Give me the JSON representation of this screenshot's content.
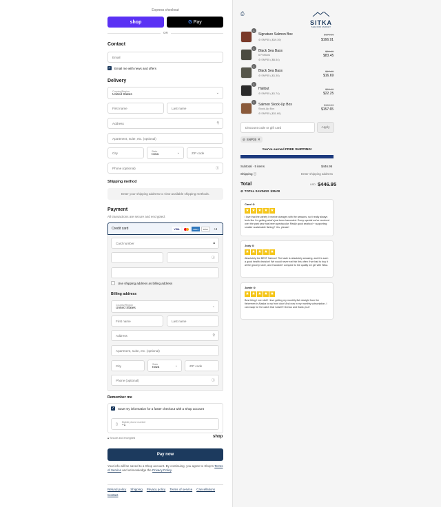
{
  "express": {
    "label": "Express checkout",
    "shop_pay": "shop",
    "gpay": "Pay",
    "or": "OR"
  },
  "contact": {
    "title": "Contact",
    "email_placeholder": "Email",
    "news_label": "Email me with news and offers"
  },
  "delivery": {
    "title": "Delivery",
    "country_label": "Country/Region",
    "country_value": "United States",
    "first_name": "First name",
    "last_name": "Last name",
    "address": "Address",
    "apartment": "Apartment, suite, etc. (optional)",
    "city": "City",
    "state_label": "State",
    "state_value": "Iowa",
    "zip": "ZIP code",
    "phone": "Phone (optional)"
  },
  "shipping": {
    "title": "Shipping method",
    "note": "Enter your shipping address to view available shipping methods."
  },
  "payment": {
    "title": "Payment",
    "subtitle": "All transactions are secure and encrypted.",
    "credit_card": "Credit card",
    "more_cards": "+4",
    "card_brands": [
      "VISA",
      "MC",
      "AMEX",
      "DISC"
    ],
    "card_number": "Card number",
    "use_shipping": "Use shipping address as billing address"
  },
  "billing": {
    "title": "Billing address",
    "country_label": "Country/Region",
    "country_value": "United States",
    "first_name": "First name",
    "last_name": "Last name",
    "address": "Address",
    "apartment": "Apartment, suite, etc. (optional)",
    "city": "City",
    "state_label": "State",
    "state_value": "Iowa",
    "zip": "ZIP code",
    "phone": "Phone (optional)"
  },
  "remember": {
    "title": "Remember me",
    "save_label": "Save my information for a faster checkout with a Shop account",
    "mobile_label": "Mobile phone number",
    "mobile_prefix": "+1",
    "secure": "Secure and encrypted",
    "shop": "shop"
  },
  "pay_button": "Pay now",
  "legal": {
    "text": "Your info will be saved to a Shop account. By continuing, you agree to Shop's",
    "terms": "Terms of Service",
    "and": "and acknowledge the",
    "privacy": "Privacy Policy",
    "end": "."
  },
  "footer": [
    "Refund policy",
    "Shipping",
    "Privacy policy",
    "Terms of service",
    "Cancellations",
    "Contact"
  ],
  "brand": {
    "name": "SITKA",
    "tagline": "SEAFOOD MARKET"
  },
  "items": [
    {
      "qty": "1",
      "name": "Signature Salmon Box",
      "variant": "",
      "discount": "SNP35 (-$19.39)",
      "original": "$179.99",
      "price": "$166.91"
    },
    {
      "qty": "1",
      "name": "Black Sea Bass",
      "variant": "6 Portions",
      "discount": "SNP35 (-$6.54)",
      "original": "$89.99",
      "price": "$83.45"
    },
    {
      "qty": "1",
      "name": "Black Sea Bass",
      "variant": "",
      "discount": "SNP35 (-$1.30)",
      "original": "$17.99",
      "price": "$16.69"
    },
    {
      "qty": "1",
      "name": "Halibut",
      "variant": "",
      "discount": "SNP35 (-$1.74)",
      "original": "$23.99",
      "price": "$22.25"
    },
    {
      "qty": "1",
      "name": "Salmon Stock-Up Box",
      "variant": "Stock-Up Box",
      "discount": "SNP35 (-$11.60)",
      "original": "$169.99",
      "price": "$157.65"
    }
  ],
  "discount": {
    "placeholder": "Discount code or gift card",
    "apply": "Apply",
    "code": "SNP35"
  },
  "free_shipping": "You've earned FREE SHIPPING!",
  "summary": {
    "subtotal_label": "Subtotal · 5 items",
    "subtotal": "$446.95",
    "shipping_label": "Shipping",
    "shipping_value": "Enter shipping address",
    "total_label": "Total",
    "currency": "USD",
    "total": "$446.95",
    "savings_label": "TOTAL SAVINGS",
    "savings": "$35.00"
  },
  "reviews": [
    {
      "name": "Carol",
      "text": "I love that the variety I receive changes with the seasons, so it really always feels like I'm getting what's just been harvested. Every special we've received over the past year has been spectacular. Really good seafood + supporting smaller sustainable fishing? Yes, please!"
    },
    {
      "name": "Judy",
      "text": "Absolutely the BEST Salmon! The taste is absolutely amazing, and it is such a good health decision! We would never eat fish this often if we had to buy it at the grocery store, and it wouldn't compare to the quality we get with Sitka."
    },
    {
      "name": "Jamie",
      "text": "Best thing I ever did!! I love getting my monthly fish straight from the fishermen in Alaska to my front door! And now in my monthly subscription, I can swap for the catch that I want!!! Genius and thank you!!"
    }
  ],
  "colors": {
    "shop_pay": "#5a31f4",
    "accent": "#1c3a5e",
    "star": "#f5c518",
    "bar": "#1c3a7e"
  }
}
